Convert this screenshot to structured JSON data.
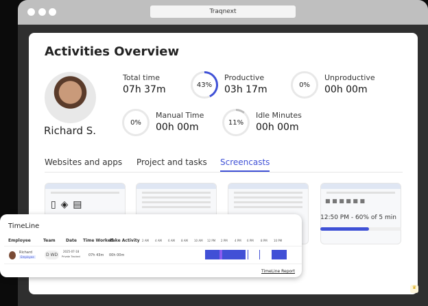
{
  "window": {
    "title": "Traqnext"
  },
  "page": {
    "title": "Activities Overview"
  },
  "user": {
    "name": "Richard S."
  },
  "stats": {
    "total": {
      "label": "Total time",
      "value": "07h 37m"
    },
    "productive": {
      "label": "Productive",
      "value": "03h 17m",
      "percent": "43%"
    },
    "unproductive": {
      "label": "Unproductive",
      "value": "00h 00m",
      "percent": "0%"
    },
    "manual": {
      "label": "Manual Time",
      "value": "00h 00m",
      "percent": "0%"
    },
    "idle": {
      "label": "Idle Minutes",
      "value": "00h 00m",
      "percent": "11%"
    }
  },
  "tabs": [
    {
      "label": "Websites and apps"
    },
    {
      "label": "Project and tasks"
    },
    {
      "label": "Screencasts",
      "active": true
    }
  ],
  "screencast": {
    "caption": "12:50 PM - 60% of 5 min",
    "progress": 0.6
  },
  "timeline": {
    "title": "TimeLine",
    "headers": [
      "Employee",
      "Team",
      "Date",
      "Time Worked",
      "Fake Activity"
    ],
    "hours": [
      "2 AM",
      "4 AM",
      "6 AM",
      "8 AM",
      "10 AM",
      "12 PM",
      "2 PM",
      "4 PM",
      "6 PM",
      "8 PM",
      "10 PM"
    ],
    "row": {
      "employee": "Richard",
      "role": "Employee",
      "team": "D WD",
      "date": "2025-07-18",
      "date_sub": "Private Tracked",
      "time_worked": "07h 43m",
      "fake_activity": "00h 00m"
    },
    "report_link": "TimeLine Report"
  },
  "colors": {
    "accent": "#3f51d6"
  }
}
